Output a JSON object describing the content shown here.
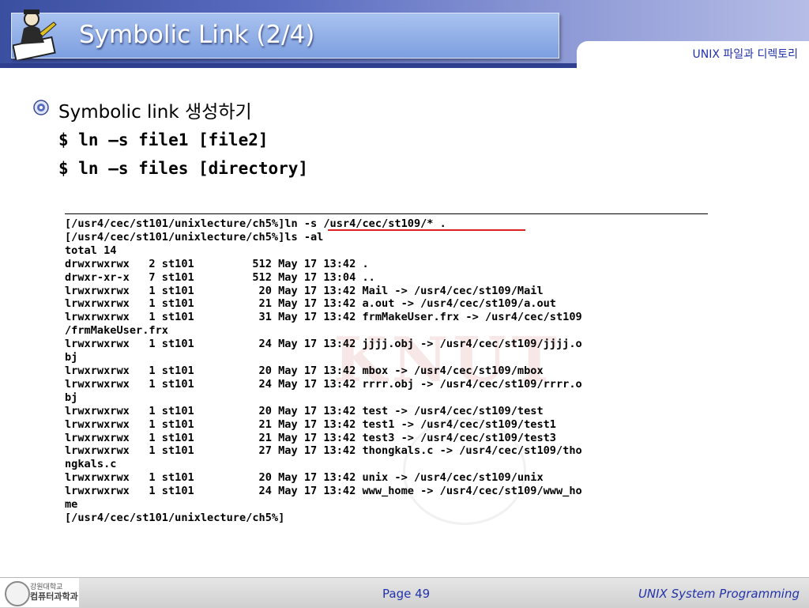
{
  "slide": {
    "title": "Symbolic Link (2/4)",
    "course_tag": "UNIX 파일과 디렉토리"
  },
  "content": {
    "bullet": "Symbolic link 생성하기",
    "commands": [
      "$ ln –s file1 [file2]",
      "$ ln –s files [directory]"
    ]
  },
  "terminal": {
    "lines": [
      "[/usr4/cec/st101/unixlecture/ch5%]ln -s /usr4/cec/st109/* .",
      "[/usr4/cec/st101/unixlecture/ch5%]ls -al",
      "total 14",
      "drwxrwxrwx   2 st101         512 May 17 13:42 .",
      "drwxr-xr-x   7 st101         512 May 17 13:04 ..",
      "lrwxrwxrwx   1 st101          20 May 17 13:42 Mail -> /usr4/cec/st109/Mail",
      "lrwxrwxrwx   1 st101          21 May 17 13:42 a.out -> /usr4/cec/st109/a.out",
      "lrwxrwxrwx   1 st101          31 May 17 13:42 frmMakeUser.frx -> /usr4/cec/st109",
      "/frmMakeUser.frx",
      "lrwxrwxrwx   1 st101          24 May 17 13:42 jjjj.obj -> /usr4/cec/st109/jjjj.o",
      "bj",
      "lrwxrwxrwx   1 st101          20 May 17 13:42 mbox -> /usr4/cec/st109/mbox",
      "lrwxrwxrwx   1 st101          24 May 17 13:42 rrrr.obj -> /usr4/cec/st109/rrrr.o",
      "bj",
      "lrwxrwxrwx   1 st101          20 May 17 13:42 test -> /usr4/cec/st109/test",
      "lrwxrwxrwx   1 st101          21 May 17 13:42 test1 -> /usr4/cec/st109/test1",
      "lrwxrwxrwx   1 st101          21 May 17 13:42 test3 -> /usr4/cec/st109/test3",
      "lrwxrwxrwx   1 st101          27 May 17 13:42 thongkals.c -> /usr4/cec/st109/tho",
      "ngkals.c",
      "lrwxrwxrwx   1 st101          20 May 17 13:42 unix -> /usr4/cec/st109/unix",
      "lrwxrwxrwx   1 st101          24 May 17 13:42 www_home -> /usr4/cec/st109/www_ho",
      "me",
      "[/usr4/cec/st101/unixlecture/ch5%]"
    ],
    "watermark": "KNUT"
  },
  "footer": {
    "dept_line1": "강원대학교",
    "dept_line2": "컴퓨터과학과",
    "page": "Page 49",
    "course": "UNIX System Programming"
  },
  "colors": {
    "header_blue": "#3b4fa0",
    "accent_text": "#2233aa",
    "highlight_red": "#e02020"
  }
}
